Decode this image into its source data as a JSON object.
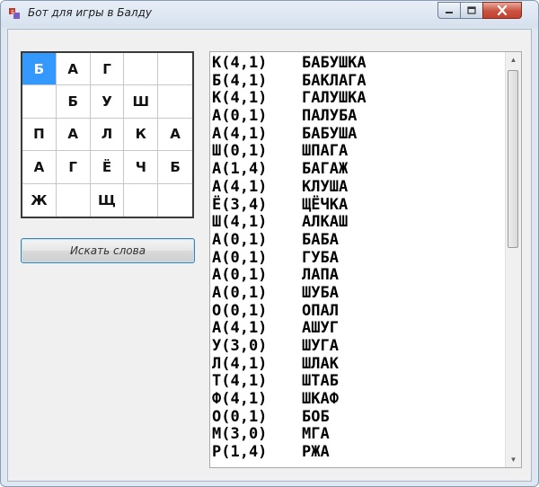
{
  "window": {
    "title": "Бот для игры в Балду"
  },
  "board": {
    "rows": [
      [
        "Б",
        "А",
        "Г",
        "",
        ""
      ],
      [
        "",
        "Б",
        "У",
        "Ш",
        ""
      ],
      [
        "П",
        "А",
        "Л",
        "К",
        "А"
      ],
      [
        "А",
        "Г",
        "Ё",
        "Ч",
        "Б"
      ],
      [
        "Ж",
        "",
        "Щ",
        "",
        ""
      ]
    ],
    "selected_cell": "0,0"
  },
  "search_button": {
    "label": "Искать слова"
  },
  "results": [
    {
      "pos": "К(4,1)",
      "word": "БАБУШКА"
    },
    {
      "pos": "Б(4,1)",
      "word": "БАКЛАГА"
    },
    {
      "pos": "К(4,1)",
      "word": "ГАЛУШКА"
    },
    {
      "pos": "А(0,1)",
      "word": "ПАЛУБА"
    },
    {
      "pos": "А(4,1)",
      "word": "БАБУША"
    },
    {
      "pos": "Ш(0,1)",
      "word": "ШПАГА"
    },
    {
      "pos": "А(1,4)",
      "word": "БАГАЖ"
    },
    {
      "pos": "А(4,1)",
      "word": "КЛУША"
    },
    {
      "pos": "Ё(3,4)",
      "word": "ЩЁЧКА"
    },
    {
      "pos": "Ш(4,1)",
      "word": "АЛКАШ"
    },
    {
      "pos": "А(0,1)",
      "word": "БАБА"
    },
    {
      "pos": "А(0,1)",
      "word": "ГУБА"
    },
    {
      "pos": "А(0,1)",
      "word": "ЛАПА"
    },
    {
      "pos": "А(0,1)",
      "word": "ШУБА"
    },
    {
      "pos": "О(0,1)",
      "word": "ОПАЛ"
    },
    {
      "pos": "А(4,1)",
      "word": "АШУГ"
    },
    {
      "pos": "У(3,0)",
      "word": "ШУГА"
    },
    {
      "pos": "Л(4,1)",
      "word": "ШЛАК"
    },
    {
      "pos": "Т(4,1)",
      "word": "ШТАБ"
    },
    {
      "pos": "Ф(4,1)",
      "word": "ШКАФ"
    },
    {
      "pos": "О(0,1)",
      "word": "БОБ"
    },
    {
      "pos": "М(3,0)",
      "word": "МГА"
    },
    {
      "pos": "Р(1,4)",
      "word": "РЖА"
    }
  ]
}
